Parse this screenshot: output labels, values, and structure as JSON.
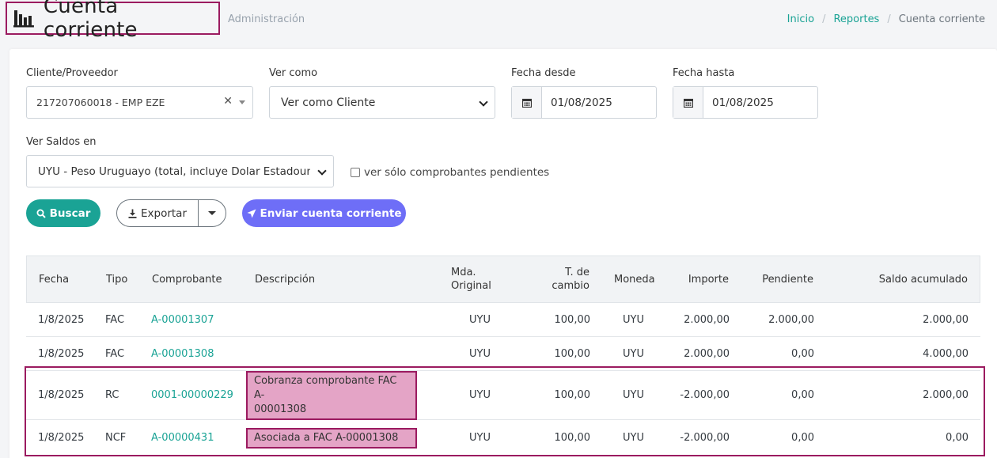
{
  "header": {
    "title": "Cuenta corriente",
    "subtitle": "Administración",
    "breadcrumb": [
      "Inicio",
      "Reportes",
      "Cuenta corriente"
    ]
  },
  "filters": {
    "client_label": "Cliente/Proveedor",
    "client_value": "217207060018 - EMP EZE",
    "ver_como_label": "Ver como",
    "ver_como_value": "Ver como Cliente",
    "fecha_desde_label": "Fecha desde",
    "fecha_desde_value": "01/08/2025",
    "fecha_hasta_label": "Fecha hasta",
    "fecha_hasta_value": "01/08/2025",
    "saldos_label": "Ver Saldos en",
    "saldos_value": "UYU - Peso Uruguayo (total, incluye Dolar Estadounidense)",
    "pendientes_label": "ver sólo comprobantes pendientes"
  },
  "actions": {
    "buscar": "Buscar",
    "exportar": "Exportar",
    "enviar": "Enviar cuenta corriente"
  },
  "table": {
    "headers": {
      "fecha": "Fecha",
      "tipo": "Tipo",
      "comprobante": "Comprobante",
      "descripcion": "Descripción",
      "mda_1": "Mda.",
      "mda_2": "Original",
      "tc_1": "T. de",
      "tc_2": "cambio",
      "moneda": "Moneda",
      "importe": "Importe",
      "pendiente": "Pendiente",
      "saldo": "Saldo acumulado"
    },
    "rows": [
      {
        "fecha": "1/8/2025",
        "tipo": "FAC",
        "comprobante": "A-00001307",
        "descripcion": "",
        "mda": "UYU",
        "tc": "100,00",
        "moneda": "UYU",
        "importe": "2.000,00",
        "pendiente": "2.000,00",
        "saldo": "2.000,00"
      },
      {
        "fecha": "1/8/2025",
        "tipo": "FAC",
        "comprobante": "A-00001308",
        "descripcion": "",
        "mda": "UYU",
        "tc": "100,00",
        "moneda": "UYU",
        "importe": "2.000,00",
        "pendiente": "0,00",
        "saldo": "4.000,00"
      },
      {
        "fecha": "1/8/2025",
        "tipo": "RC",
        "comprobante": "0001-00000229",
        "descripcion_1": "Cobranza comprobante FAC A-",
        "descripcion_2": "00001308",
        "mda": "UYU",
        "tc": "100,00",
        "moneda": "UYU",
        "importe": "-2.000,00",
        "pendiente": "0,00",
        "saldo": "2.000,00"
      },
      {
        "fecha": "1/8/2025",
        "tipo": "NCF",
        "comprobante": "A-00000431",
        "descripcion": "Asociada a FAC A-00001308",
        "mda": "UYU",
        "tc": "100,00",
        "moneda": "UYU",
        "importe": "-2.000,00",
        "pendiente": "0,00",
        "saldo": "0,00"
      }
    ]
  },
  "colors": {
    "accent": "#1aa395",
    "purple_button": "#6e6ef7",
    "highlight_border": "#9b1b60",
    "highlight_fill": "#e4a4c6"
  }
}
